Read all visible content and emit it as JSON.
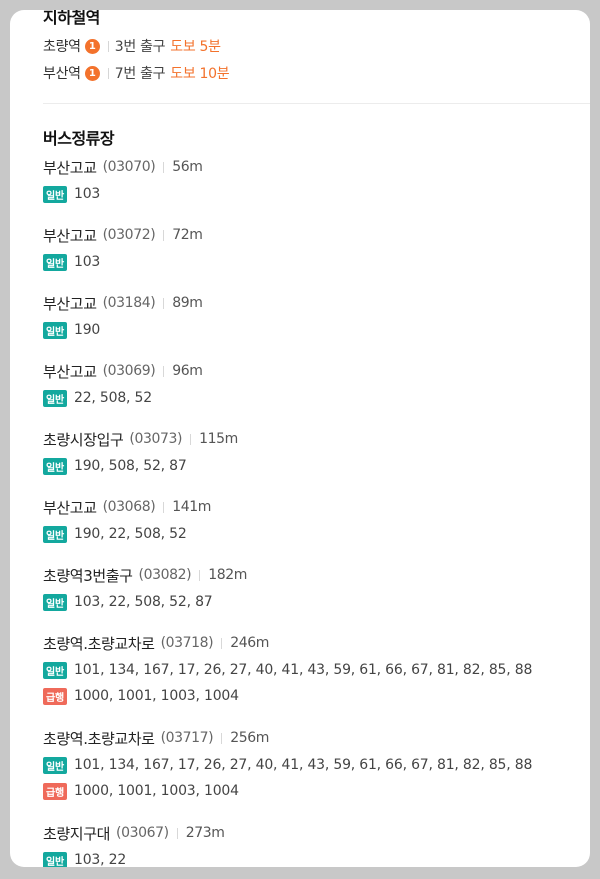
{
  "subway": {
    "title": "지하철역",
    "stations": [
      {
        "name": "초량역",
        "line": "1",
        "exit": "3번 출구",
        "walk": "도보 5분"
      },
      {
        "name": "부산역",
        "line": "1",
        "exit": "7번 출구",
        "walk": "도보 10분"
      }
    ],
    "line_color": "#f3722c"
  },
  "bus": {
    "title": "버스정류장",
    "colors": {
      "general": "#13a89e",
      "express": "#ef6a5a"
    },
    "stops": [
      {
        "name": "부산고교",
        "id": "(03070)",
        "dist": "56m",
        "routes": [
          {
            "type": "일반",
            "list": "103"
          }
        ]
      },
      {
        "name": "부산고교",
        "id": "(03072)",
        "dist": "72m",
        "routes": [
          {
            "type": "일반",
            "list": "103"
          }
        ]
      },
      {
        "name": "부산고교",
        "id": "(03184)",
        "dist": "89m",
        "routes": [
          {
            "type": "일반",
            "list": "190"
          }
        ]
      },
      {
        "name": "부산고교",
        "id": "(03069)",
        "dist": "96m",
        "routes": [
          {
            "type": "일반",
            "list": "22, 508, 52"
          }
        ]
      },
      {
        "name": "초량시장입구",
        "id": "(03073)",
        "dist": "115m",
        "routes": [
          {
            "type": "일반",
            "list": "190, 508, 52, 87"
          }
        ]
      },
      {
        "name": "부산고교",
        "id": "(03068)",
        "dist": "141m",
        "routes": [
          {
            "type": "일반",
            "list": "190, 22, 508, 52"
          }
        ]
      },
      {
        "name": "초량역3번출구",
        "id": "(03082)",
        "dist": "182m",
        "routes": [
          {
            "type": "일반",
            "list": "103, 22, 508, 52, 87"
          }
        ]
      },
      {
        "name": "초량역.초량교차로",
        "id": "(03718)",
        "dist": "246m",
        "routes": [
          {
            "type": "일반",
            "list": "101, 134, 167, 17, 26, 27, 40, 41, 43, 59, 61, 66, 67, 81, 82, 85, 88"
          },
          {
            "type": "급행",
            "list": "1000, 1001, 1003, 1004"
          }
        ]
      },
      {
        "name": "초량역.초량교차로",
        "id": "(03717)",
        "dist": "256m",
        "routes": [
          {
            "type": "일반",
            "list": "101, 134, 167, 17, 26, 27, 40, 41, 43, 59, 61, 66, 67, 81, 82, 85, 88"
          },
          {
            "type": "급행",
            "list": "1000, 1001, 1003, 1004"
          }
        ]
      },
      {
        "name": "초량지구대",
        "id": "(03067)",
        "dist": "273m",
        "routes": [
          {
            "type": "일반",
            "list": "103, 22"
          }
        ]
      }
    ]
  }
}
